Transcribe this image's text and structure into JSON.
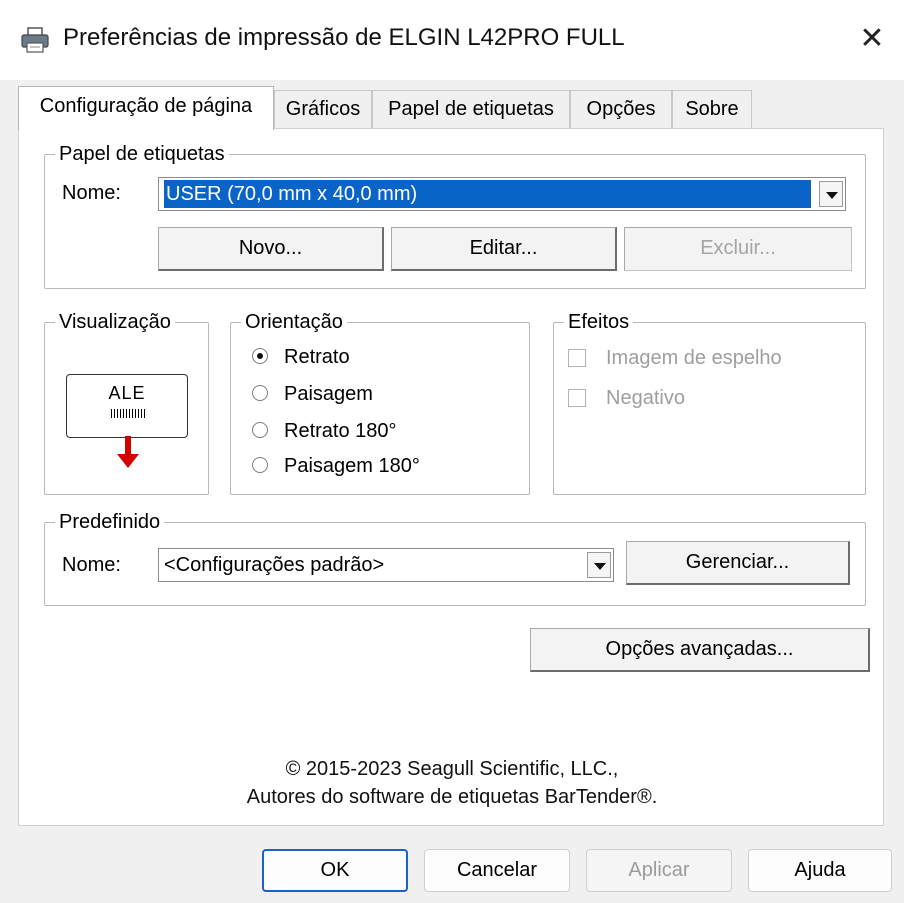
{
  "window": {
    "title": "Preferências de impressão de ELGIN L42PRO FULL",
    "close_symbol": "✕",
    "icon": "printer-icon"
  },
  "tabs": [
    {
      "label": "Configuração de página",
      "active": true
    },
    {
      "label": "Gráficos",
      "active": false
    },
    {
      "label": "Papel de etiquetas",
      "active": false
    },
    {
      "label": "Opções",
      "active": false
    },
    {
      "label": "Sobre",
      "active": false
    }
  ],
  "label_paper": {
    "group_title": "Papel de etiquetas",
    "name_label": "Nome:",
    "selected_value": "USER (70,0 mm x 40,0 mm)",
    "buttons": {
      "new": "Novo...",
      "edit": "Editar...",
      "delete": "Excluir..."
    }
  },
  "preview": {
    "group_title": "Visualização",
    "label_text": "ALE",
    "arrow_color": "#d40000"
  },
  "orientation": {
    "group_title": "Orientação",
    "options": [
      "Retrato",
      "Paisagem",
      "Retrato 180°",
      "Paisagem 180°"
    ],
    "selected": "Retrato"
  },
  "effects": {
    "group_title": "Efeitos",
    "options": [
      "Imagem de espelho",
      "Negativo"
    ],
    "enabled": false
  },
  "preset": {
    "group_title": "Predefinido",
    "name_label": "Nome:",
    "selected_value": "<Configurações padrão>",
    "manage_button": "Gerenciar..."
  },
  "advanced_button": "Opções avançadas...",
  "copyright": {
    "line1": "© 2015-2023 Seagull Scientific, LLC.,",
    "line2": "Autores do software de etiquetas BarTender®."
  },
  "footer": {
    "ok": "OK",
    "cancel": "Cancelar",
    "apply": "Aplicar",
    "help": "Ajuda"
  },
  "colors": {
    "selection": "#0a64c8",
    "primary_button_border": "#1a63c4"
  }
}
